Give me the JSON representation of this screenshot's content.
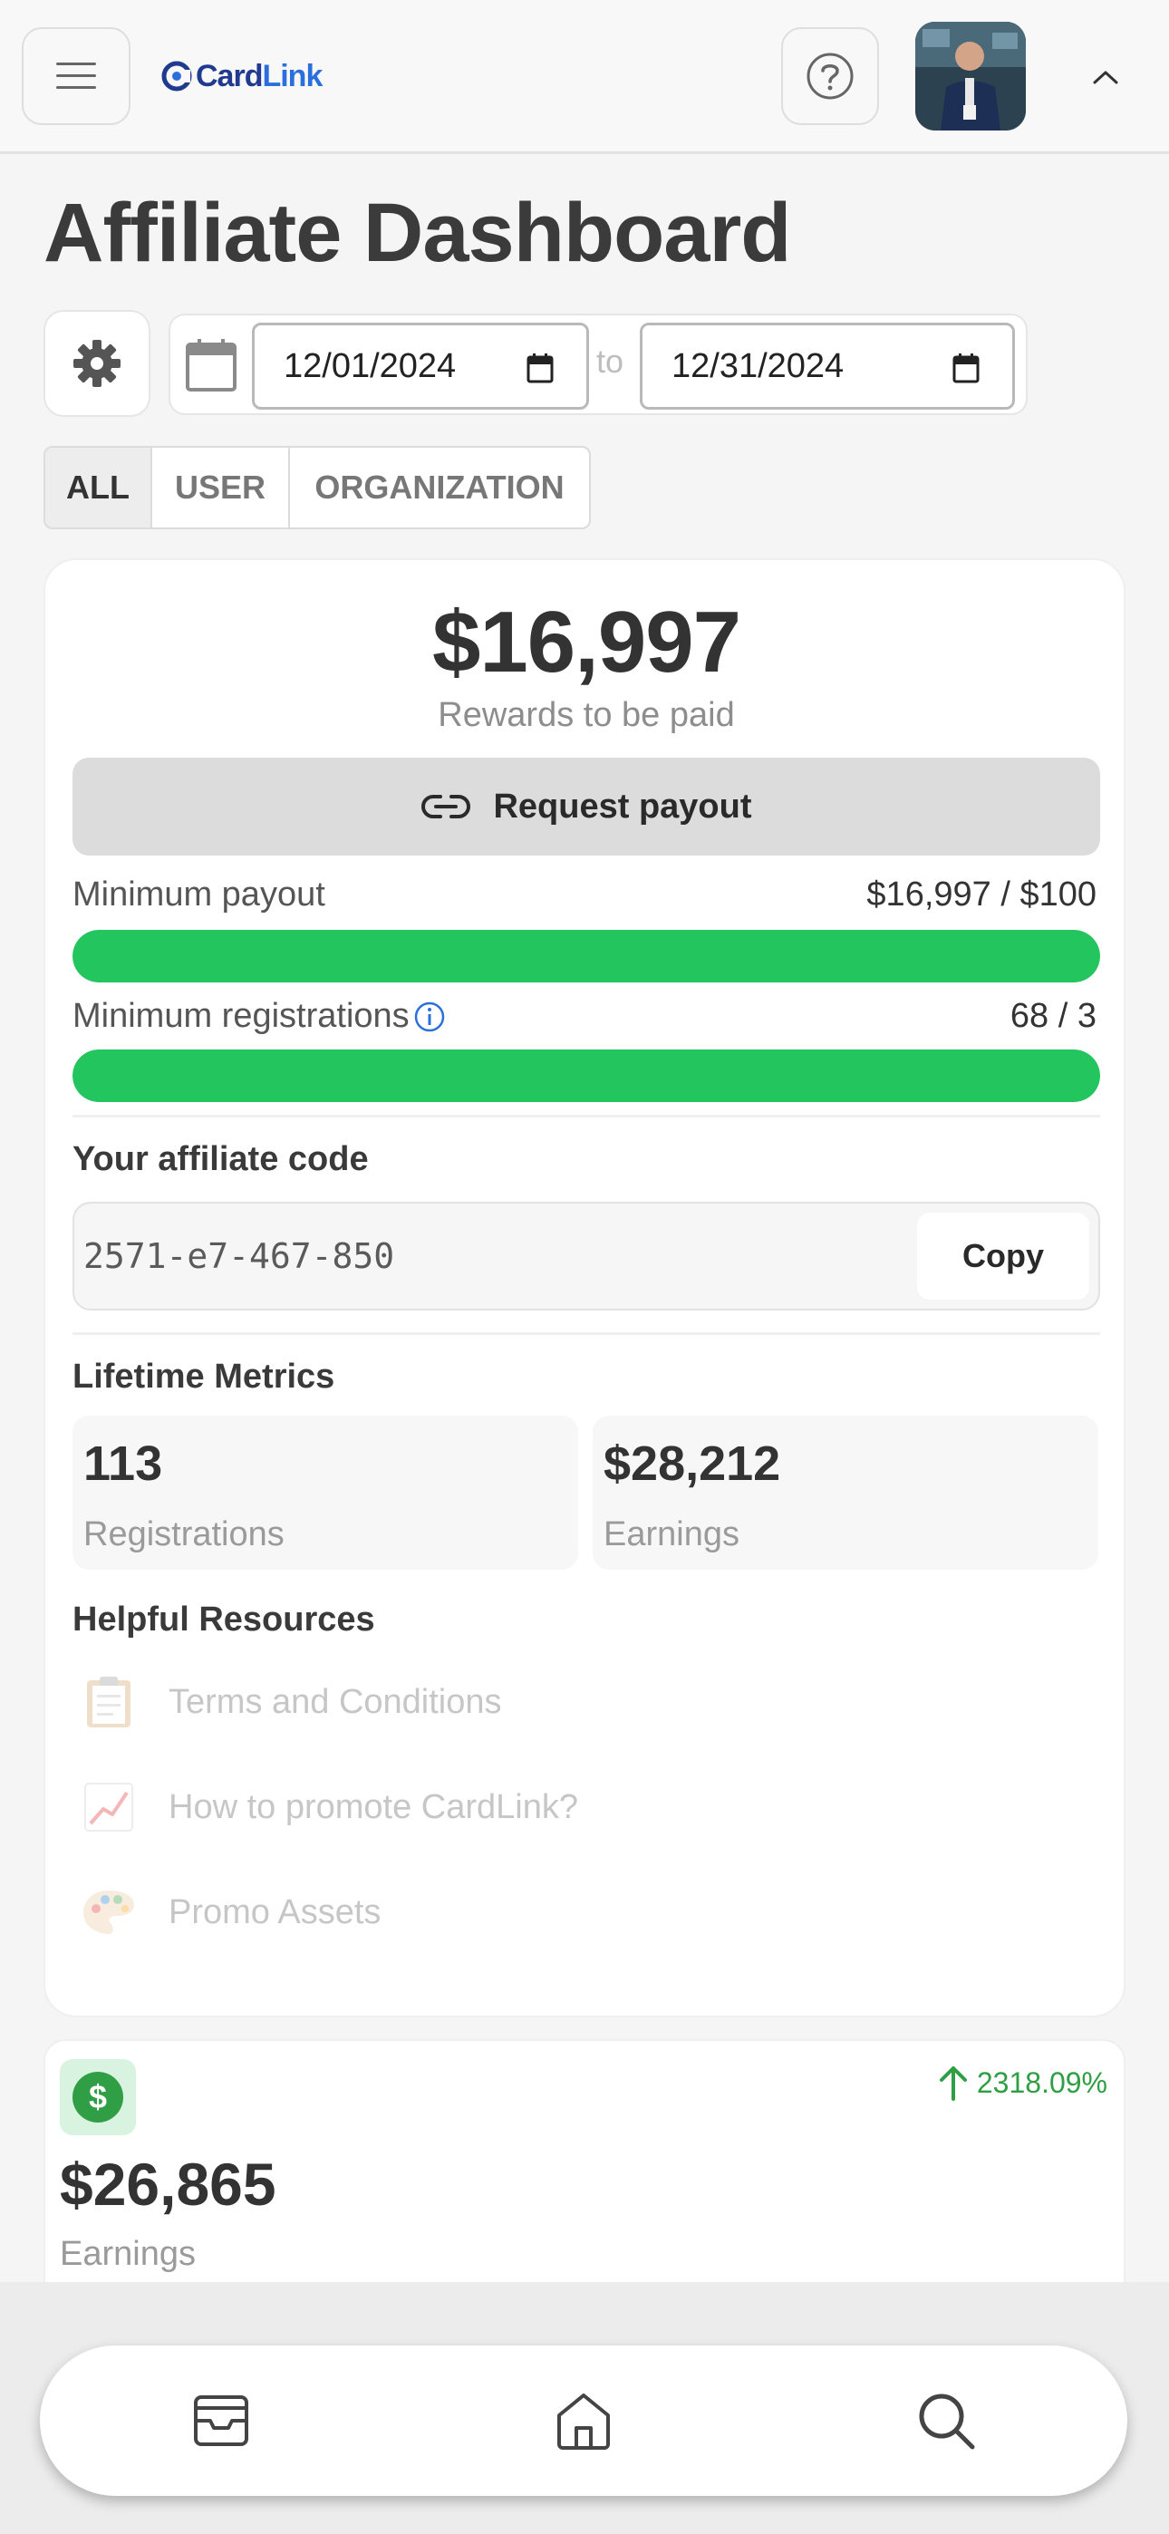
{
  "header": {
    "logo_text_1": "Card",
    "logo_text_2": "Link"
  },
  "page": {
    "title": "Affiliate Dashboard"
  },
  "filters": {
    "start_date": "12/01/2024",
    "to_label": "to",
    "end_date": "12/31/2024",
    "segments": [
      "ALL",
      "USER",
      "ORGANIZATION"
    ],
    "active_segment": "ALL"
  },
  "rewards": {
    "amount": "$16,997",
    "label": "Rewards to be paid",
    "payout_button": "Request payout"
  },
  "progress": {
    "min_payout_label": "Minimum payout",
    "min_payout_value": "$16,997 / $100",
    "min_payout_fraction": 1.0,
    "min_registrations_label": "Minimum registrations",
    "min_registrations_value": "68 / 3",
    "min_registrations_fraction": 1.0
  },
  "affiliate": {
    "heading": "Your affiliate code",
    "code": "2571-e7-467-850",
    "copy_label": "Copy"
  },
  "lifetime": {
    "heading": "Lifetime Metrics",
    "registrations_value": "113",
    "registrations_label": "Registrations",
    "earnings_value": "$28,212",
    "earnings_label": "Earnings"
  },
  "resources": {
    "heading": "Helpful Resources",
    "items": [
      {
        "label": "Terms and Conditions",
        "icon": "clipboard-icon"
      },
      {
        "label": "How to promote CardLink?",
        "icon": "chart-increasing-icon"
      },
      {
        "label": "Promo Assets",
        "icon": "palette-icon"
      }
    ]
  },
  "earnings_card": {
    "value": "$26,865",
    "label": "Earnings",
    "change": "2318.09%",
    "change_color": "#2f9e44"
  },
  "colors": {
    "accent_green": "#22c55e",
    "brand_dark": "#1f3a8f",
    "brand_light": "#2a6fdb"
  },
  "bottom_nav": {
    "items": [
      "inbox-icon",
      "home-icon",
      "search-icon"
    ]
  }
}
